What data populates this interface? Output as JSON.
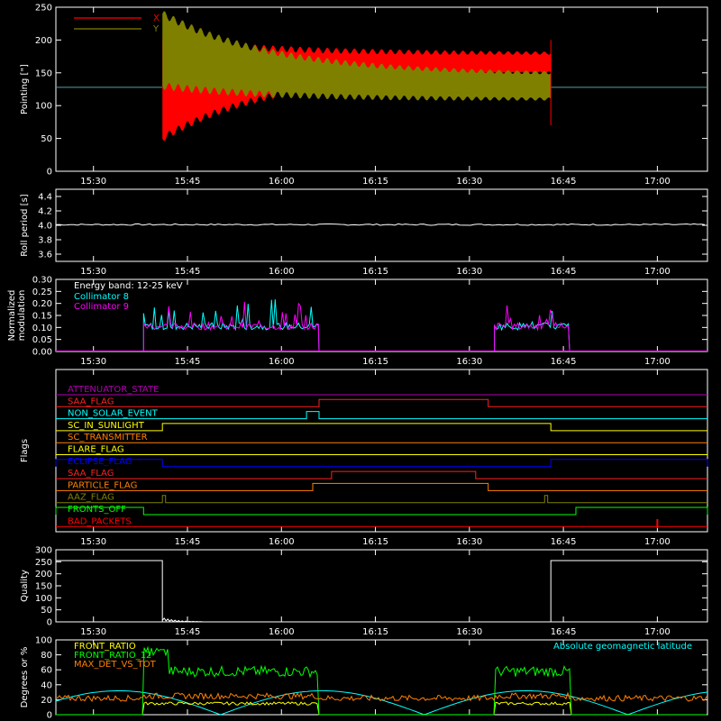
{
  "time_ticks": [
    "15:30",
    "15:45",
    "16:00",
    "16:15",
    "16:30",
    "16:45",
    "17:00"
  ],
  "chart_data": [
    {
      "name": "pointing",
      "type": "line",
      "ylabel": "Pointing [\"]",
      "yticks": [
        "0",
        "50",
        "100",
        "150",
        "200",
        "250"
      ],
      "ylim": [
        0,
        250
      ],
      "series": [
        {
          "name": "X",
          "color": "#ff0000",
          "env_start": [
            50,
            200
          ],
          "env_end": [
            150,
            180
          ],
          "active_from": "15:41",
          "active_to": "16:43"
        },
        {
          "name": "Y",
          "color": "#808000",
          "env_start": [
            130,
            240
          ],
          "env_end": [
            110,
            150
          ],
          "active_from": "15:41",
          "active_to": "16:43"
        }
      ],
      "baseline": 128
    },
    {
      "name": "roll",
      "type": "line",
      "ylabel": "Roll period [s]",
      "yticks": [
        "3.6",
        "3.8",
        "4.0",
        "4.2",
        "4.4"
      ],
      "ylim": [
        3.5,
        4.5
      ],
      "series": [
        {
          "name": "",
          "color": "#ffffff",
          "value": 4.01
        }
      ]
    },
    {
      "name": "modulation",
      "type": "line",
      "ylabel": "Normalized modulation",
      "ylabel_lines": [
        "Normalized",
        "modulation"
      ],
      "yticks": [
        "0.00",
        "0.05",
        "0.10",
        "0.15",
        "0.20",
        "0.25",
        "0.30"
      ],
      "ylim": [
        0,
        0.3
      ],
      "annotation": "Energy band: 12-25 keV",
      "series": [
        {
          "name": "Collimator 8",
          "color": "#00ffff"
        },
        {
          "name": "Collimator 9",
          "color": "#ff00ff"
        }
      ],
      "active_ranges": [
        [
          "15:38",
          "16:06"
        ],
        [
          "16:34",
          "16:46"
        ]
      ]
    },
    {
      "name": "flags",
      "type": "line",
      "ylabel": "Flags",
      "flags": [
        {
          "name": "ATTENUATOR_STATE",
          "color": "#b000b0"
        },
        {
          "name": "SAA_FLAG",
          "color": "#ff2020"
        },
        {
          "name": "NON_SOLAR_EVENT",
          "color": "#00ffff"
        },
        {
          "name": "SC_IN_SUNLIGHT",
          "color": "#ffff00"
        },
        {
          "name": "SC_TRANSMITTER",
          "color": "#ff8000"
        },
        {
          "name": "FLARE_FLAG",
          "color": "#ffff00"
        },
        {
          "name": "ECLIPSE_FLAG",
          "color": "#0000ff"
        },
        {
          "name": "SAA_FLAG",
          "color": "#ff2020"
        },
        {
          "name": "PARTICLE_FLAG",
          "color": "#ff8000"
        },
        {
          "name": "AAZ_FLAG",
          "color": "#808000"
        },
        {
          "name": "FRONTS_OFF",
          "color": "#00ff00"
        },
        {
          "name": "BAD_PACKETS",
          "color": "#ff0000"
        }
      ]
    },
    {
      "name": "quality",
      "type": "line",
      "ylabel": "Quality",
      "yticks": [
        "0",
        "50",
        "100",
        "150",
        "200",
        "250",
        "300"
      ],
      "ylim": [
        0,
        300
      ],
      "series": [
        {
          "name": "",
          "color": "#ffffff"
        }
      ]
    },
    {
      "name": "ratios",
      "type": "line",
      "ylabel": "Degrees or %",
      "yticks": [
        "0",
        "20",
        "40",
        "60",
        "80",
        "100"
      ],
      "ylim": [
        0,
        100
      ],
      "annotation": "Absolute geomagnetic latitude",
      "annotation_color": "#00ffff",
      "series": [
        {
          "name": "FRONT_RATIO",
          "color": "#ffff00"
        },
        {
          "name": "FRONT_RATIO_12",
          "color": "#00ff00"
        },
        {
          "name": "MAX_DET_VS_TOT",
          "color": "#ff8000"
        }
      ]
    }
  ]
}
